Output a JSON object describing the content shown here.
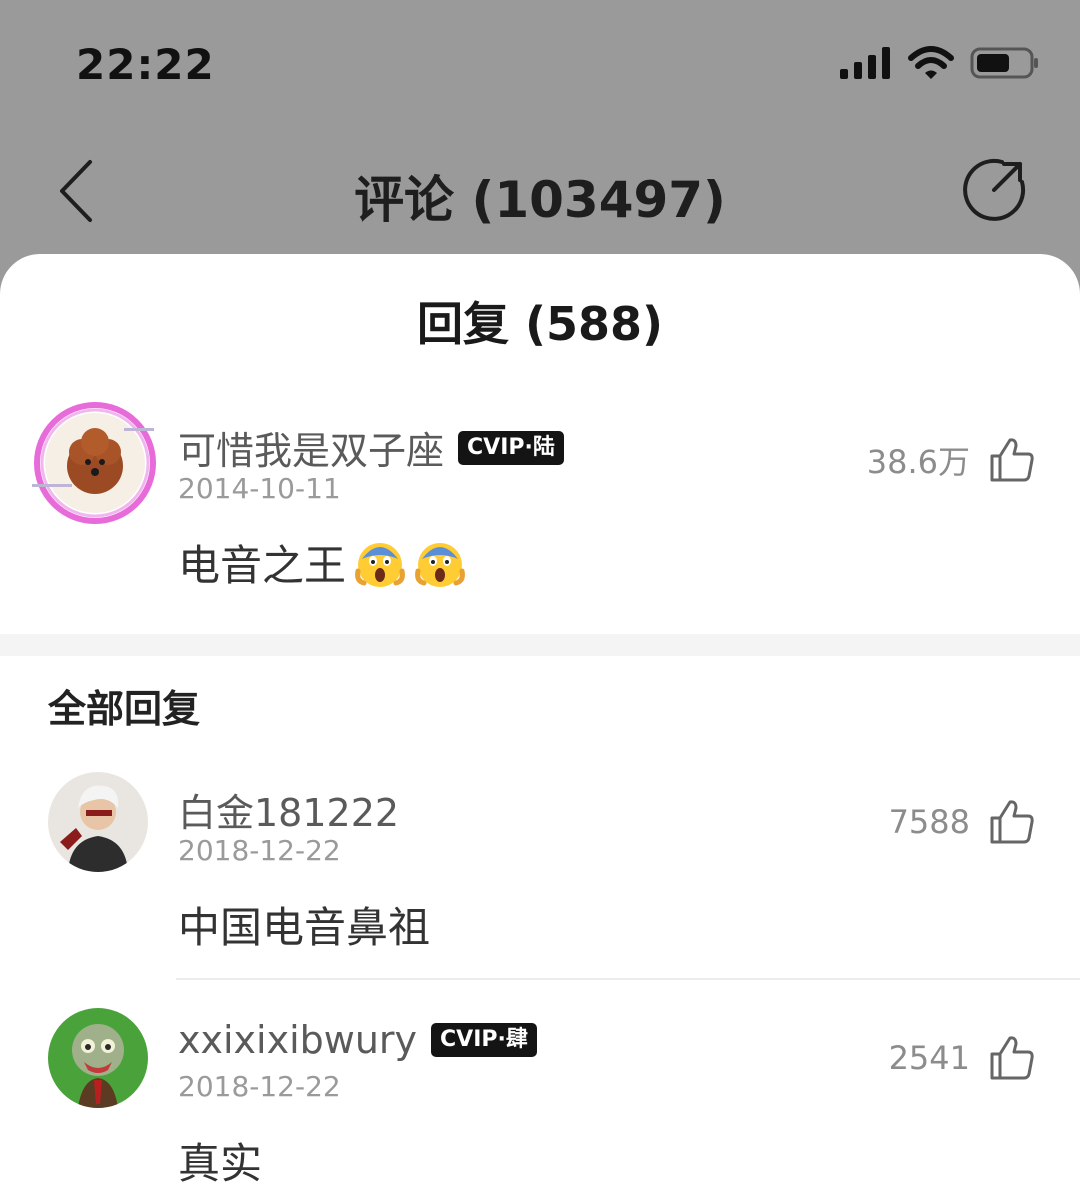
{
  "status": {
    "time": "22:22"
  },
  "nav": {
    "title": "评论 (103497)"
  },
  "sheet": {
    "title": "回复 (588)"
  },
  "main_comment": {
    "user": "可惜我是双子座",
    "vip": "CVIP·陆",
    "date": "2014-10-11",
    "likes": "38.6万",
    "content": "电音之王",
    "emojis": [
      "face-screaming-in-fear",
      "face-screaming-in-fear"
    ]
  },
  "section": {
    "label": "全部回复"
  },
  "replies": [
    {
      "user": "白金181222",
      "vip": "",
      "date": "2018-12-22",
      "likes": "7588",
      "content": "中国电音鼻祖"
    },
    {
      "user": "xxixixibwury",
      "vip": "CVIP·肆",
      "date": "2018-12-22",
      "likes": "2541",
      "content": "真实"
    }
  ],
  "colors": {
    "overlay": "#9a9a9a",
    "sheet": "#ffffff",
    "band": "#f4f4f4"
  }
}
